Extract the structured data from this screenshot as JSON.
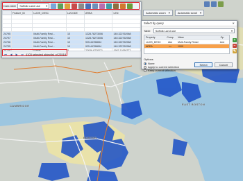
{
  "colors": {
    "highlight_red": "#e01b24",
    "water": "#9dc6e0",
    "land": "#cfd3cc",
    "selected_blue": "#1a4fc7",
    "unselected_yellow": "#efe6a1",
    "row_select": "#cfe2f7",
    "query_row": "#f7a04a"
  },
  "datatable": {
    "label": "Data table",
    "layer": "Suffolk Land use",
    "columns": [
      "",
      "Feature_ID",
      "LUOS_DESC",
      "LUCODE",
      "AREA",
      "LEN"
    ],
    "rows": [
      [
        "",
        "",
        "",
        "",
        "",
        ""
      ],
      [
        "",
        "",
        "",
        "",
        "",
        ""
      ],
      [
        "",
        "",
        "",
        "",
        "",
        ""
      ],
      [
        "",
        "",
        "",
        "",
        "",
        ""
      ],
      [
        "24795",
        "",
        "Multi-Family Resi...",
        "10",
        "1228.78273006",
        "140.322762968"
      ],
      [
        "24797",
        "",
        "Multi-Family Resi...",
        "10",
        "1228.78273006",
        "140.322762968"
      ],
      [
        "24736",
        "",
        "Multi-Family Resi...",
        "10",
        "925.44786654",
        "140.322762968"
      ],
      [
        "24735",
        "",
        "Multi-Family Resi...",
        "10",
        "925.44786654",
        "140.322762968"
      ],
      [
        "24739",
        "",
        "Forest",
        "3",
        "22639.8728271",
        "1587.11836277"
      ]
    ],
    "status": "4103 selected object(s) of 23518"
  },
  "toolbar": {
    "zoom_mode": "Automatic zoom",
    "scroll_mode": "Automatic scroll"
  },
  "dialog": {
    "title": "Select by query",
    "table_label": "Table",
    "table_value": "Suffolk Land use",
    "query_columns": [
      "Property",
      "Comp",
      "Value",
      "",
      "Op"
    ],
    "query_rows": [
      [
        "LUOS_DESC",
        "Like",
        "Multi-Family Resid",
        "",
        "And"
      ],
      [
        "AREA",
        ">=",
        "1000",
        "",
        ""
      ]
    ],
    "options_label": "Options",
    "options": [
      "None",
      "Apply to current selection",
      "Keep current selection"
    ],
    "selected_option": 0,
    "select_button": "Select",
    "cancel_button": "Cancel"
  },
  "map_labels": [
    "CAMBRIDGE",
    "BOSTON",
    "CHELSEA",
    "EAST BOSTON"
  ]
}
